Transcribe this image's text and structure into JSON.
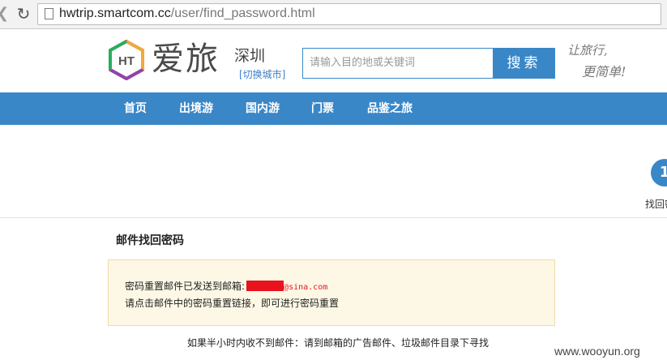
{
  "browser": {
    "url_host": "hwtrip.smartcom.cc",
    "url_path": "/user/find_password.html"
  },
  "header": {
    "logo_badge": "HT",
    "logo_text": "爱旅",
    "city": "深圳",
    "switch_city": "[切换城市]",
    "search_placeholder": "请输入目的地或关键词",
    "search_button": "搜索",
    "slogan_line1": "让旅行,",
    "slogan_line2": "更简单!"
  },
  "nav": {
    "items": [
      {
        "label": "首页"
      },
      {
        "label": "出境游"
      },
      {
        "label": "国内游"
      },
      {
        "label": "门票"
      },
      {
        "label": "品鉴之旅"
      }
    ]
  },
  "side": {
    "step_number": "1",
    "step_label": "找回密"
  },
  "main": {
    "title": "邮件找回密码",
    "notice_line1_prefix": "密码重置邮件已发送到邮箱:",
    "notice_email_domain": "@sina.com",
    "notice_line2": "请点击邮件中的密码重置链接，即可进行密码重置",
    "footnote": "如果半小时内收不到邮件：请到邮箱的广告邮件、垃圾邮件目录下寻找"
  },
  "watermark": "www.wooyun.org",
  "colors": {
    "brand_blue": "#3a87c8",
    "notice_bg": "#fdf8e6",
    "redaction": "#e8131d"
  }
}
